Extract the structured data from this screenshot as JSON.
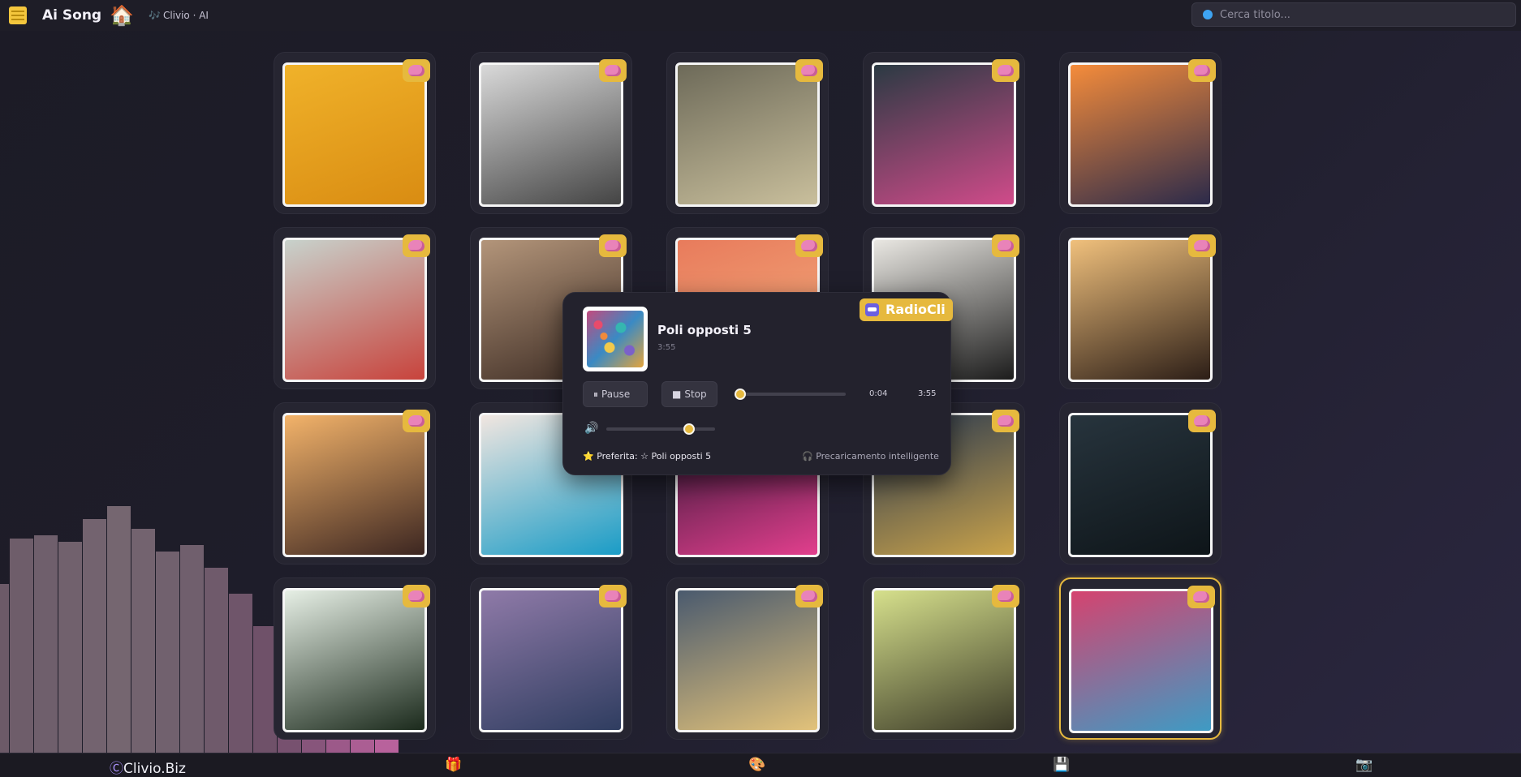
{
  "header": {
    "app_title": "Ai Song",
    "home_icon": "🏠",
    "brand_note": "🎶",
    "brand_sub": "Clivio · AI",
    "search_placeholder": "Cerca titolo..."
  },
  "grid": {
    "badge_icon": "brain-icon",
    "cards": [
      {
        "art": [
          "#f0b22a",
          "#d98c12"
        ],
        "selected": false
      },
      {
        "art": [
          "#d9d9d9",
          "#444444"
        ],
        "selected": false
      },
      {
        "art": [
          "#6d6a59",
          "#c9bf9c"
        ],
        "selected": false
      },
      {
        "art": [
          "#2b3a43",
          "#d04b8a"
        ],
        "selected": false
      },
      {
        "art": [
          "#f58c3b",
          "#2b2a4a"
        ],
        "selected": false
      },
      {
        "art": [
          "#c8d2cc",
          "#c8433c"
        ],
        "selected": false
      },
      {
        "art": [
          "#b3957a",
          "#3c2b23"
        ],
        "selected": false
      },
      {
        "art": [
          "#e87b5c",
          "#f4b07e"
        ],
        "selected": false
      },
      {
        "art": [
          "#e9e7e2",
          "#1c1c1c"
        ],
        "selected": false
      },
      {
        "art": [
          "#f0c07c",
          "#2c1e17"
        ],
        "selected": false
      },
      {
        "art": [
          "#f3b36a",
          "#3c2621"
        ],
        "selected": false
      },
      {
        "art": [
          "#f1e6e0",
          "#1a9cc6"
        ],
        "selected": false
      },
      {
        "art": [
          "#2b1533",
          "#e23f8d"
        ],
        "selected": false
      },
      {
        "art": [
          "#283850",
          "#caa34a"
        ],
        "selected": false
      },
      {
        "art": [
          "#27343d",
          "#0e1519"
        ],
        "selected": false
      },
      {
        "art": [
          "#e6efe5",
          "#1b2a1c"
        ],
        "selected": false
      },
      {
        "art": [
          "#8f7aa8",
          "#2f3d60"
        ],
        "selected": false
      },
      {
        "art": [
          "#4a5a6e",
          "#e2c27a"
        ],
        "selected": false
      },
      {
        "art": [
          "#d6e08c",
          "#3c3b28"
        ],
        "selected": false
      },
      {
        "art": [
          "#d5436f",
          "#3e9bc4"
        ],
        "selected": true
      }
    ]
  },
  "player": {
    "title": "Poli opposti 5",
    "duration_small": "3:55",
    "radio_badge": "RadioCli",
    "pause_icon": "⏸",
    "pause_label": "Pause",
    "stop_icon": "■",
    "stop_label": "Stop",
    "progress": 0.017,
    "time_current": "0:04",
    "time_total": "3:55",
    "volume_icon": "🔊",
    "volume": 0.76,
    "favorite_icon": "⭐",
    "favorite_text": "Preferita: ☆ Poli opposti 5",
    "preload_icon": "🎧",
    "preload_text": "Precaricamento intelligente",
    "accent_color": "#e6b93e"
  },
  "visualizer": {
    "levels": [
      0.52,
      0.66,
      0.67,
      0.65,
      0.72,
      0.76,
      0.69,
      0.62,
      0.64,
      0.57,
      0.49,
      0.39,
      0.29,
      0.27,
      0.18,
      0.12,
      0.04
    ]
  },
  "bottombar": {
    "brand_symbol": "Ⓒ",
    "brand": "Clivio.Biz",
    "gift_icon": "🎁",
    "palette_icon": "🎨",
    "save_icon": "💾",
    "camera_icon": "📷"
  }
}
